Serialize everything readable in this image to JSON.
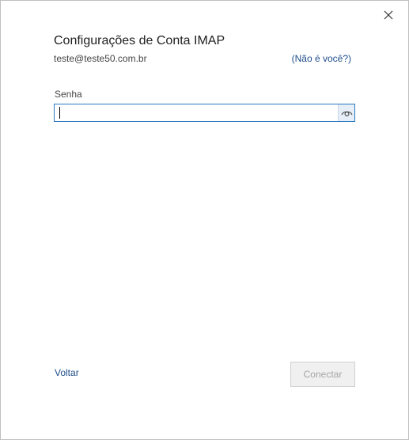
{
  "dialog": {
    "title": "Configurações de Conta IMAP",
    "email": "teste@teste50.com.br",
    "not_you_link": "(Não é você?)",
    "close_icon": "close-icon"
  },
  "password": {
    "label": "Senha",
    "value": "",
    "reveal_icon": "eye-icon"
  },
  "footer": {
    "back_label": "Voltar",
    "connect_label": "Conectar"
  },
  "colors": {
    "link": "#1f4e8c",
    "focus_border": "#2b78c2",
    "disabled_text": "#a6a6a6",
    "disabled_bg": "#f0f0f0"
  }
}
